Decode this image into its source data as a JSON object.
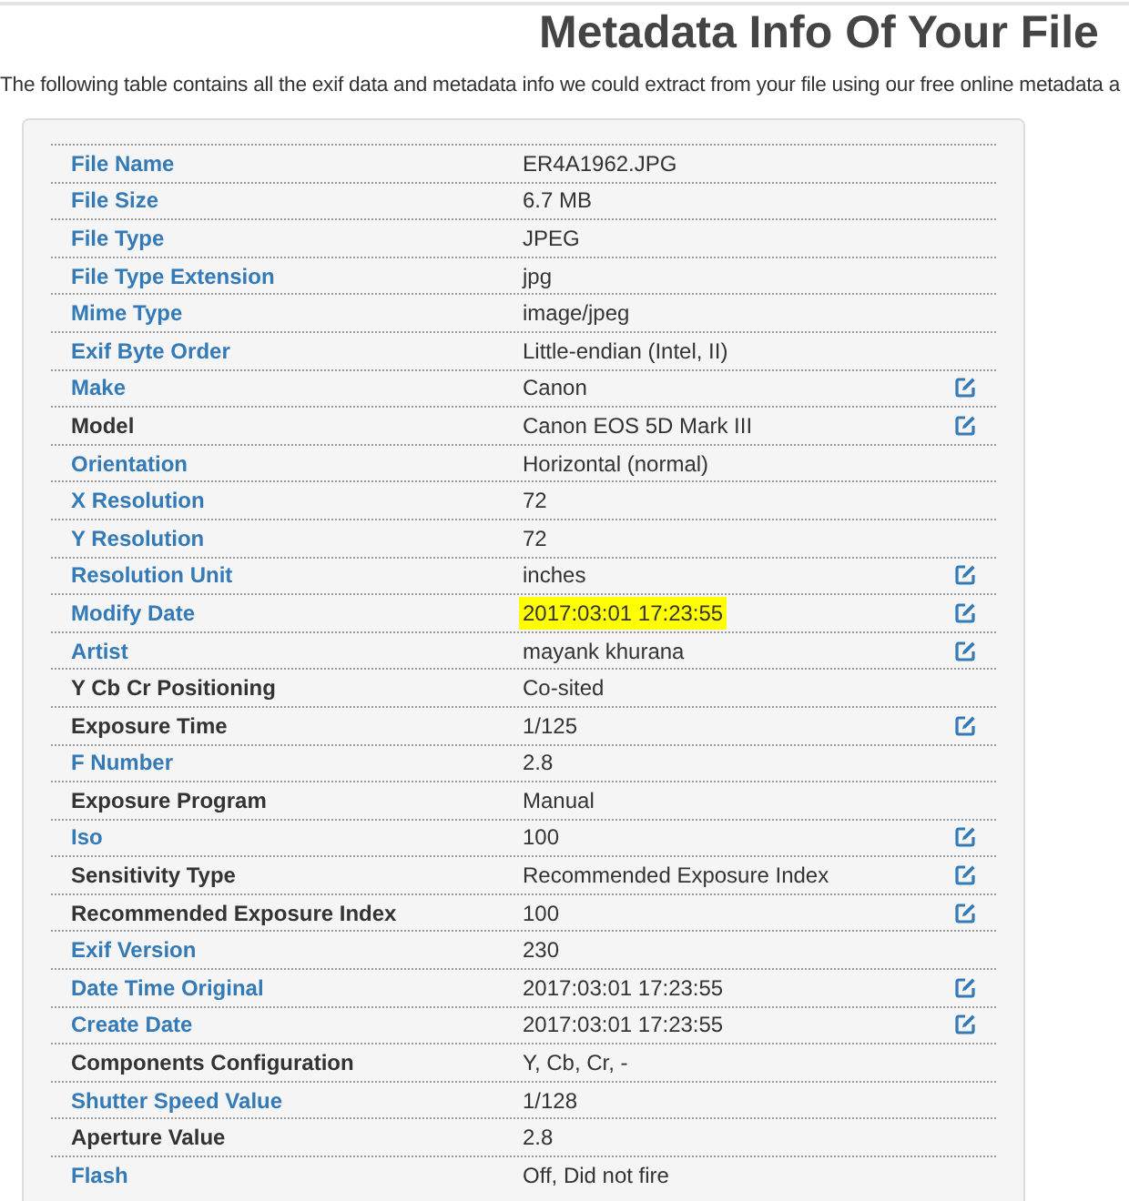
{
  "title": "Metadata Info Of Your File",
  "intro": "The following table contains all the exif data and metadata info we could extract from your file using our free online metadata a",
  "rows": [
    {
      "label": "File Name",
      "kind": "link",
      "value": "ER4A1962.JPG",
      "editable": false,
      "highlighted": false
    },
    {
      "label": "File Size",
      "kind": "link",
      "value": "6.7 MB",
      "editable": false,
      "highlighted": false
    },
    {
      "label": "File Type",
      "kind": "link",
      "value": "JPEG",
      "editable": false,
      "highlighted": false
    },
    {
      "label": "File Type Extension",
      "kind": "link",
      "value": "jpg",
      "editable": false,
      "highlighted": false
    },
    {
      "label": "Mime Type",
      "kind": "link",
      "value": "image/jpeg",
      "editable": false,
      "highlighted": false
    },
    {
      "label": "Exif Byte Order",
      "kind": "link",
      "value": "Little-endian (Intel, II)",
      "editable": false,
      "highlighted": false
    },
    {
      "label": "Make",
      "kind": "link",
      "value": "Canon",
      "editable": true,
      "highlighted": false
    },
    {
      "label": "Model",
      "kind": "plain",
      "value": "Canon EOS 5D Mark III",
      "editable": true,
      "highlighted": false
    },
    {
      "label": "Orientation",
      "kind": "link",
      "value": "Horizontal (normal)",
      "editable": false,
      "highlighted": false
    },
    {
      "label": "X Resolution",
      "kind": "link",
      "value": "72",
      "editable": false,
      "highlighted": false
    },
    {
      "label": "Y Resolution",
      "kind": "link",
      "value": "72",
      "editable": false,
      "highlighted": false
    },
    {
      "label": "Resolution Unit",
      "kind": "link",
      "value": "inches",
      "editable": true,
      "highlighted": false
    },
    {
      "label": "Modify Date",
      "kind": "link",
      "value": "2017:03:01 17:23:55",
      "editable": true,
      "highlighted": true
    },
    {
      "label": "Artist",
      "kind": "link",
      "value": "mayank khurana",
      "editable": true,
      "highlighted": false
    },
    {
      "label": "Y Cb Cr Positioning",
      "kind": "plain",
      "value": "Co-sited",
      "editable": false,
      "highlighted": false
    },
    {
      "label": "Exposure Time",
      "kind": "plain",
      "value": "1/125",
      "editable": true,
      "highlighted": false
    },
    {
      "label": "F Number",
      "kind": "link",
      "value": "2.8",
      "editable": false,
      "highlighted": false
    },
    {
      "label": "Exposure Program",
      "kind": "plain",
      "value": "Manual",
      "editable": false,
      "highlighted": false
    },
    {
      "label": "Iso",
      "kind": "link",
      "value": "100",
      "editable": true,
      "highlighted": false
    },
    {
      "label": "Sensitivity Type",
      "kind": "plain",
      "value": "Recommended Exposure Index",
      "editable": true,
      "highlighted": false
    },
    {
      "label": "Recommended Exposure Index",
      "kind": "plain",
      "value": "100",
      "editable": true,
      "highlighted": false
    },
    {
      "label": "Exif Version",
      "kind": "link",
      "value": "230",
      "editable": false,
      "highlighted": false
    },
    {
      "label": "Date Time Original",
      "kind": "link",
      "value": "2017:03:01 17:23:55",
      "editable": true,
      "highlighted": false
    },
    {
      "label": "Create Date",
      "kind": "link",
      "value": "2017:03:01 17:23:55",
      "editable": true,
      "highlighted": false
    },
    {
      "label": "Components Configuration",
      "kind": "plain",
      "value": "Y, Cb, Cr, -",
      "editable": false,
      "highlighted": false
    },
    {
      "label": "Shutter Speed Value",
      "kind": "link",
      "value": "1/128",
      "editable": false,
      "highlighted": false
    },
    {
      "label": "Aperture Value",
      "kind": "plain",
      "value": "2.8",
      "editable": false,
      "highlighted": false
    },
    {
      "label": "Flash",
      "kind": "link",
      "value": "Off, Did not fire",
      "editable": false,
      "highlighted": false
    }
  ]
}
